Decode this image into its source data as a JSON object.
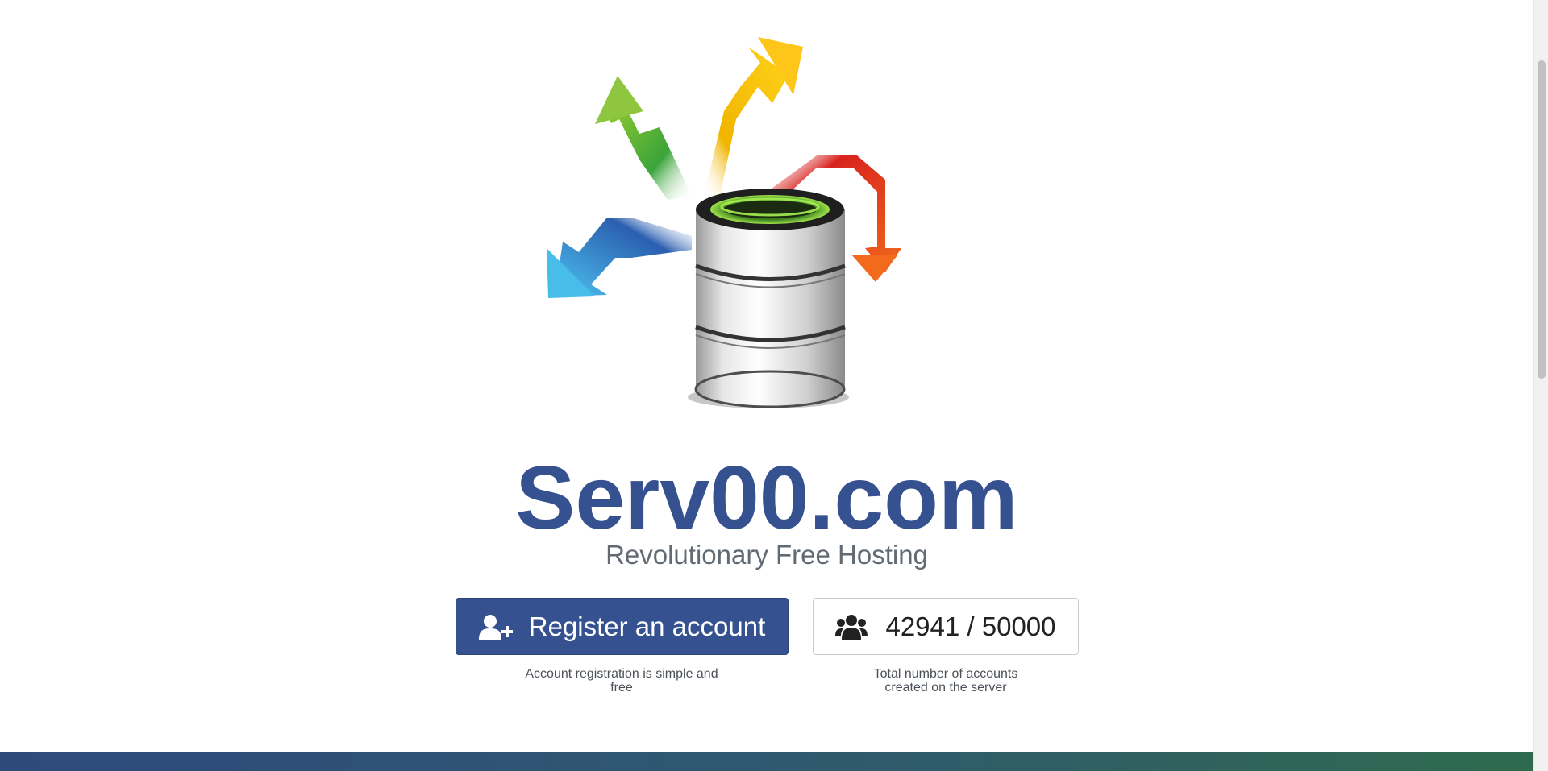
{
  "brand": {
    "title": "Serv00.com",
    "subtitle": "Revolutionary Free Hosting",
    "hero_image": "database-arrows-icon"
  },
  "register": {
    "label": "Register an account",
    "icon": "user-plus-icon",
    "caption": "Account registration is simple and free"
  },
  "accounts": {
    "counter": "42941 / 50000",
    "icon": "users-icon",
    "caption": "Total number of accounts created on the server",
    "progress_fraction": 0.8588
  },
  "colors": {
    "brand_blue": "#35518f",
    "subtitle_gray": "#626a73",
    "footer_start": "#2e4a7d",
    "footer_end": "#2f6a4e"
  }
}
